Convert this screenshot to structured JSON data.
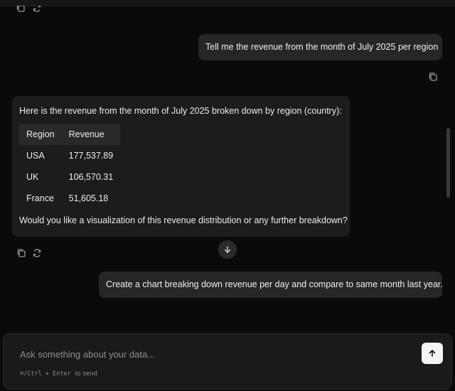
{
  "messages": {
    "user_1": "Tell me the revenue from the month of July 2025 per region",
    "assistant_1": {
      "intro": "Here is the revenue from the month of July 2025 broken down by region (country):",
      "table": {
        "headers": [
          "Region",
          "Revenue"
        ],
        "rows": [
          [
            "USA",
            "177,537.89"
          ],
          [
            "UK",
            "106,570.31"
          ],
          [
            "France",
            "51,605.18"
          ]
        ]
      },
      "outro": "Would you like a visualization of this revenue distribution or any further breakdown?"
    },
    "user_2": "Create a chart breaking down revenue per day and compare to same month last year."
  },
  "composer": {
    "placeholder": "Ask something about your data...",
    "shortcut_keys": "⌘/Ctrl + Enter",
    "shortcut_label": "to send"
  },
  "icons": {
    "copy": "copy-icon",
    "regenerate": "regenerate-icon",
    "scroll_down": "arrow-down-icon",
    "send": "arrow-up-icon"
  },
  "colors": {
    "background": "#0a0a0b",
    "bubble_user": "#262628",
    "bubble_assistant": "#1c1c1e",
    "send_button": "#f4f4f4"
  }
}
